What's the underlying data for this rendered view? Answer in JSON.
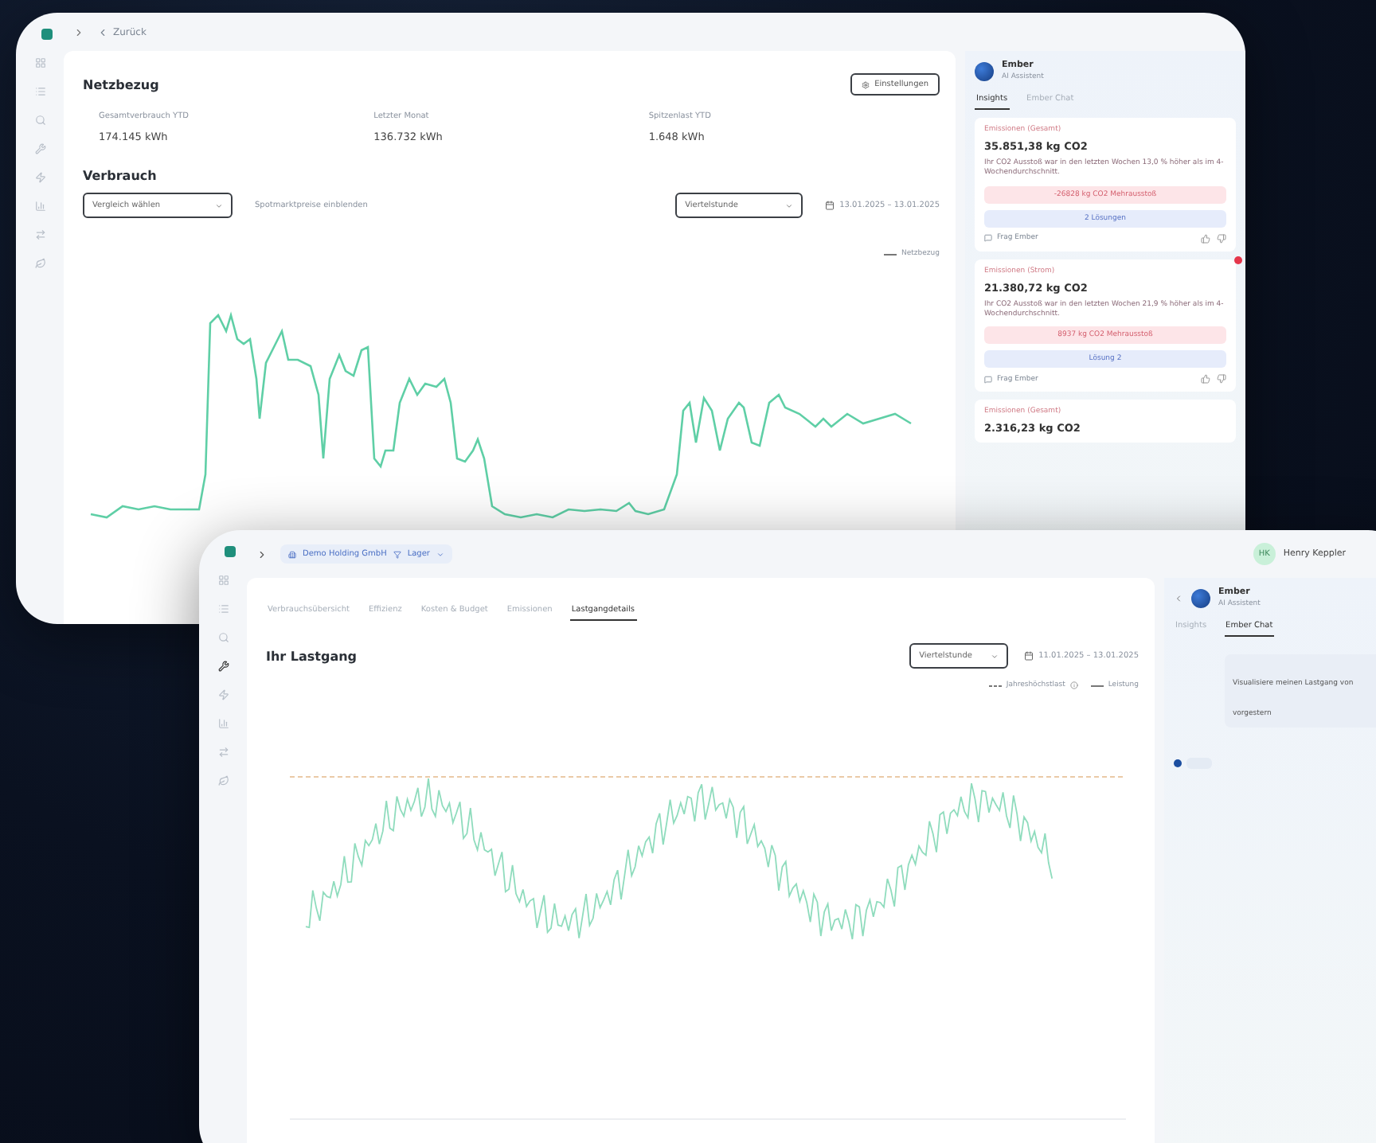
{
  "back_window": {
    "back_link": "Zurück",
    "section_title": "Netzbezug",
    "settings_button": "Einstellungen",
    "stats": [
      {
        "label": "Gesamtverbrauch YTD",
        "value": "174.145 kWh"
      },
      {
        "label": "Letzter Monat",
        "value": "136.732 kWh"
      },
      {
        "label": "Spitzenlast YTD",
        "value": "1.648 kWh"
      }
    ],
    "consumption_title": "Verbrauch",
    "compare_select": "Vergleich wählen",
    "spot_toggle": "Spotmarktpreise einblenden",
    "interval_select": "Viertelstunde",
    "date_range": "13.01.2025 – 13.01.2025",
    "legend": "Netzbezug",
    "assistant": {
      "name": "Ember",
      "subtitle": "AI Assistent",
      "tabs": [
        {
          "label": "Insights",
          "selected": true
        },
        {
          "label": "Ember Chat",
          "selected": false
        }
      ],
      "cards": [
        {
          "category": "Emissionen (Gesamt)",
          "value": "35.851,38 kg CO2",
          "text": "Ihr CO2 Ausstoß war in den letzten Wochen 13,0 % höher als im 4-Wochendurchschnitt.",
          "alert": "-26828 kg CO2 Mehrausstoß",
          "action": "2 Lösungen",
          "ask": "Frag Ember",
          "unread": false
        },
        {
          "category": "Emissionen (Strom)",
          "value": "21.380,72 kg CO2",
          "text": "Ihr CO2 Ausstoß war in den letzten Wochen 21,9 % höher als im 4-Wochendurchschnitt.",
          "alert": "8937 kg CO2 Mehrausstoß",
          "action": "Lösung 2",
          "ask": "Frag Ember",
          "unread": true
        },
        {
          "category": "Emissionen (Gesamt)",
          "value": "2.316,23 kg CO2",
          "unread": false
        }
      ]
    }
  },
  "front_window": {
    "company_filter": "Demo Holding GmbH",
    "location_filter": "Lager",
    "user": {
      "initials": "HK",
      "name": "Henry Keppler"
    },
    "tabs": [
      {
        "label": "Verbrauchsübersicht",
        "selected": false
      },
      {
        "label": "Effizienz",
        "selected": false
      },
      {
        "label": "Kosten & Budget",
        "selected": false
      },
      {
        "label": "Emissionen",
        "selected": false
      },
      {
        "label": "Lastgangdetails",
        "selected": true
      }
    ],
    "chart_title": "Ihr Lastgang",
    "interval_select": "Viertelstunde",
    "date_range": "11.01.2025 – 13.01.2025",
    "legend": [
      {
        "label": "Jahreshöchstlast",
        "kind": "dashed"
      },
      {
        "label": "Leistung",
        "kind": "solid"
      }
    ],
    "assistant": {
      "name": "Ember",
      "subtitle": "AI Assistent",
      "tabs": [
        {
          "label": "Insights",
          "selected": false
        },
        {
          "label": "Ember Chat",
          "selected": true
        }
      ],
      "message": "Visualisiere meinen Lastgang von vorgestern"
    }
  }
}
